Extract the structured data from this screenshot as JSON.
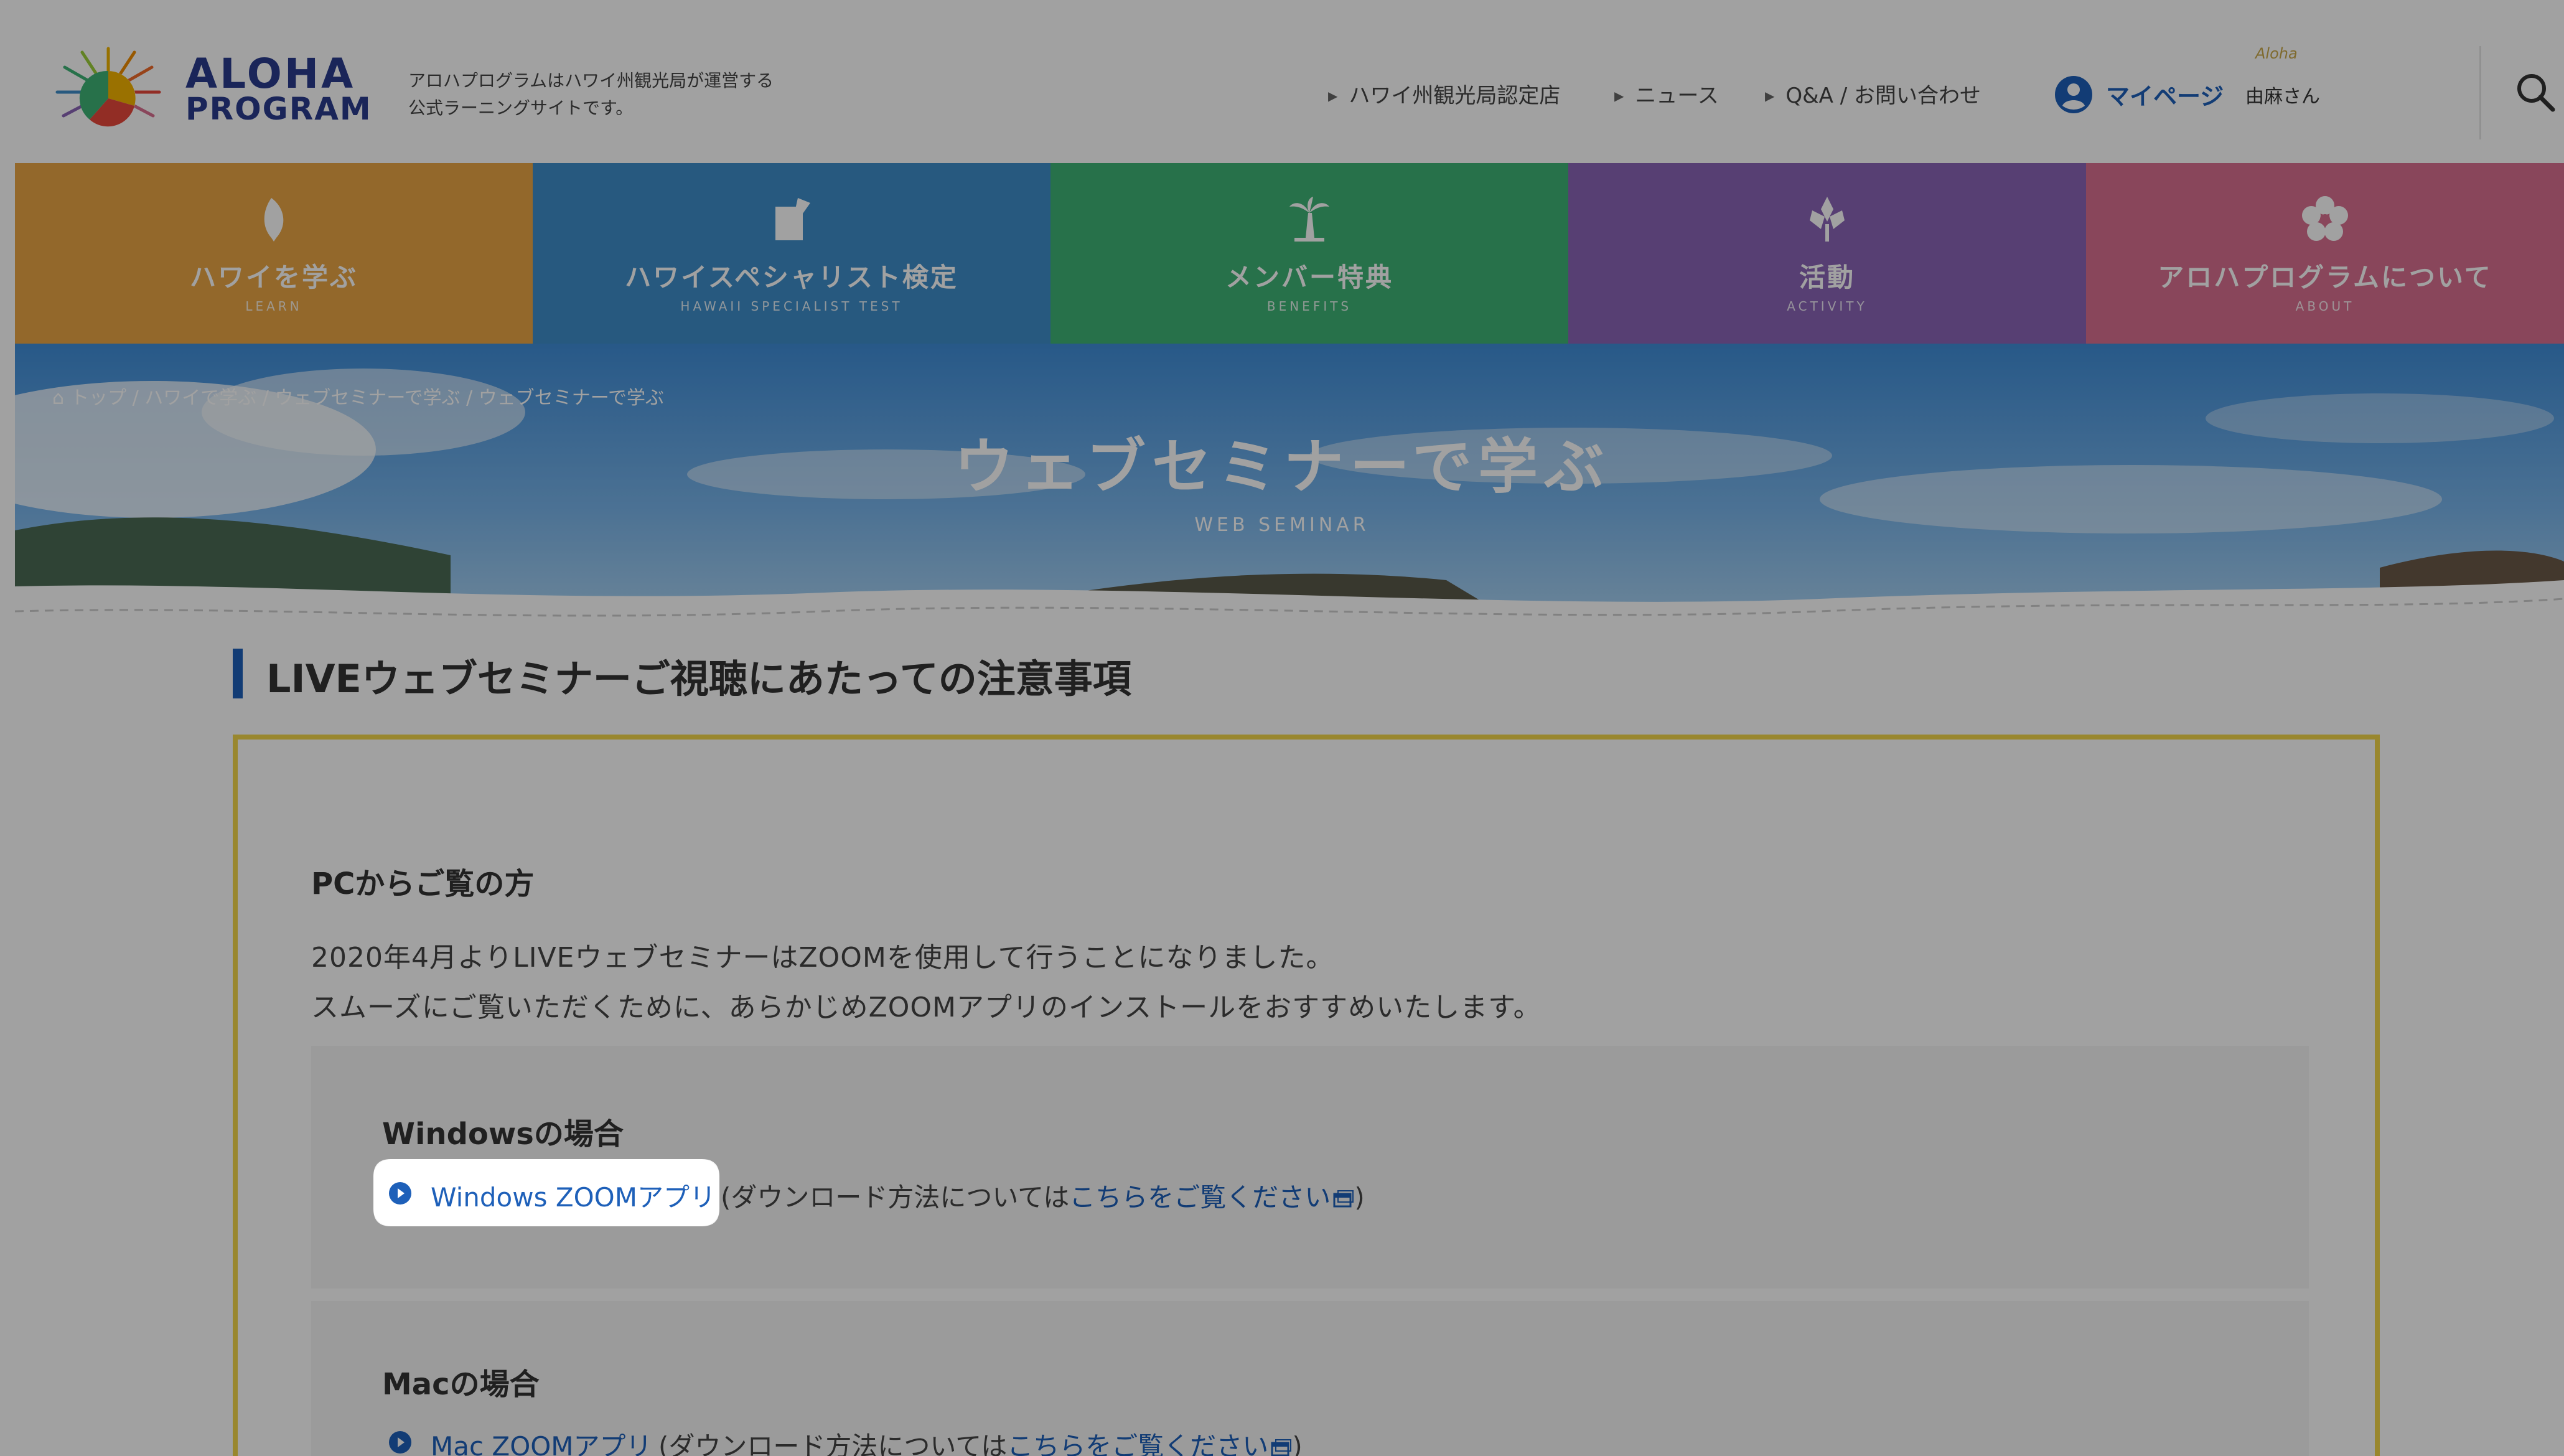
{
  "header": {
    "logo_line1": "ALOHA",
    "logo_line2": "PROGRAM",
    "tagline_line1": "アロハプログラムはハワイ州観光局が運営する",
    "tagline_line2": "公式ラーニングサイトです。",
    "nav": [
      {
        "label": "ハワイ州観光局認定店"
      },
      {
        "label": "ニュース"
      },
      {
        "label": "Q&A / お問い合わせ"
      }
    ],
    "mypage_label": "マイページ",
    "username": "由麻さん",
    "aloha_deco": "Aloha",
    "icons": {
      "logo": "aloha-program-logo",
      "user": "user-circle-icon",
      "search": "search-icon"
    }
  },
  "categories": [
    {
      "label": "ハワイを学ぶ",
      "sub": "LEARN",
      "color": "#e9a545",
      "icon": "leaf-icon"
    },
    {
      "label": "ハワイスペシャリスト検定",
      "sub": "HAWAII SPECIALIST TEST",
      "color": "#3f8ec9",
      "icon": "certificate-icon"
    },
    {
      "label": "メンバー特典",
      "sub": "BENEFITS",
      "color": "#3fb476",
      "icon": "palm-tree-icon"
    },
    {
      "label": "活動",
      "sub": "ACTIVITY",
      "color": "#8a64b7",
      "icon": "flower-icon"
    },
    {
      "label": "アロハプログラムについて",
      "sub": "ABOUT",
      "color": "#d97090",
      "icon": "hibiscus-icon"
    }
  ],
  "hero": {
    "breadcrumb": "トップ / ハワイで学ぶ / ウェブセミナーで学ぶ / ウェブセミナーで学ぶ",
    "title": "ウェブセミナーで学ぶ",
    "subtitle": "WEB SEMINAR"
  },
  "content": {
    "section_heading": "LIVEウェブセミナーご視聴にあたっての注意事項",
    "pc_heading": "PCからご覧の方",
    "pc_text_1": "2020年4月よりLIVEウェブセミナーはZOOMを使用して行うことになりました。",
    "pc_text_2": "スムーズにご覧いただくために、あらかじめZOOMアプリのインストールをおすすめいたします。",
    "windows": {
      "heading": "Windowsの場合",
      "link_label": "Windows ZOOMアプリ",
      "note_prefix": "(ダウンロード方法については",
      "note_link": "こちらをご覧ください",
      "note_suffix": ")"
    },
    "mac": {
      "heading": "Macの場合",
      "link_label": "Mac ZOOMアプリ",
      "note_prefix": "(ダウンロード方法については",
      "note_link": "こちらをご覧ください",
      "note_suffix": ")"
    }
  },
  "colors": {
    "accent": "#1e60b9",
    "box_border": "#f3d64a"
  }
}
